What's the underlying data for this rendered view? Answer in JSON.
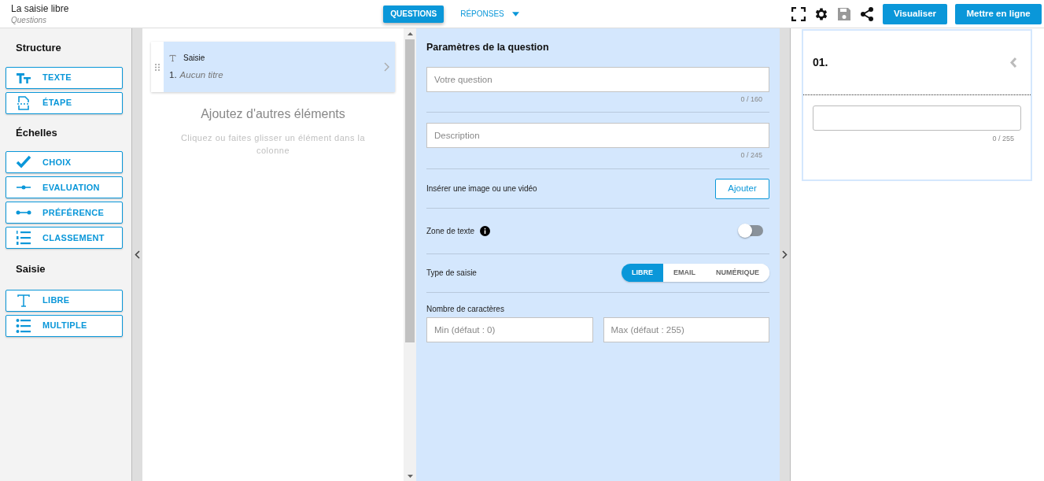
{
  "header": {
    "title": "La saisie libre",
    "subtitle": "Questions"
  },
  "tabs": [
    {
      "label": "QUESTIONS",
      "selected": true,
      "dropdown": false
    },
    {
      "label": "RÉPONSES",
      "selected": false,
      "dropdown": true
    }
  ],
  "toolbar": {
    "save_disabled": true,
    "buttons": [
      "Visualiser",
      "Mettre en ligne"
    ]
  },
  "sidebar": [
    {
      "title": "Structure",
      "items": [
        {
          "label": "TEXTE",
          "kind": "text-size"
        },
        {
          "label": "ÉTAPE",
          "kind": "page-break"
        }
      ]
    },
    {
      "title": "Échelles",
      "items": [
        {
          "label": "CHOIX",
          "kind": "check"
        },
        {
          "label": "EVALUATION",
          "kind": "slider"
        },
        {
          "label": "PRÉFÉRENCE",
          "kind": "range"
        },
        {
          "label": "CLASSEMENT",
          "kind": "ordered-list"
        }
      ]
    },
    {
      "title": "Saisie",
      "items": [
        {
          "label": "LIBRE",
          "kind": "text"
        },
        {
          "label": "MULTIPLE",
          "kind": "list"
        }
      ]
    }
  ],
  "elements": [
    {
      "type": "Saisie",
      "number": "1.",
      "title": "Aucun titre",
      "selected": true
    }
  ],
  "empty_state": {
    "title": "Ajoutez d'autres éléments",
    "hint": "Cliquez ou faites glisser un élément dans la colonne"
  },
  "settings": {
    "title": "Paramètres de la question",
    "question": {
      "placeholder": "Votre question",
      "counter": "0 / 160"
    },
    "description": {
      "placeholder": "Description",
      "counter": "0 / 245"
    },
    "media": {
      "label": "Insérer une image ou une vidéo",
      "button": "Ajouter"
    },
    "text_area": {
      "label": "Zone de texte",
      "on": false
    },
    "input_type": {
      "label": "Type de saisie",
      "options": [
        {
          "label": "LIBRE",
          "selected": true
        },
        {
          "label": "EMAIL",
          "selected": false
        },
        {
          "label": "NUMÉRIQUE",
          "selected": false
        }
      ]
    },
    "char_count": {
      "label": "Nombre de caractères",
      "min_placeholder": "Min (défaut : 0)",
      "max_placeholder": "Max (défaut : 255)"
    }
  },
  "preview": {
    "number": "01.",
    "counter": "0 / 255"
  }
}
